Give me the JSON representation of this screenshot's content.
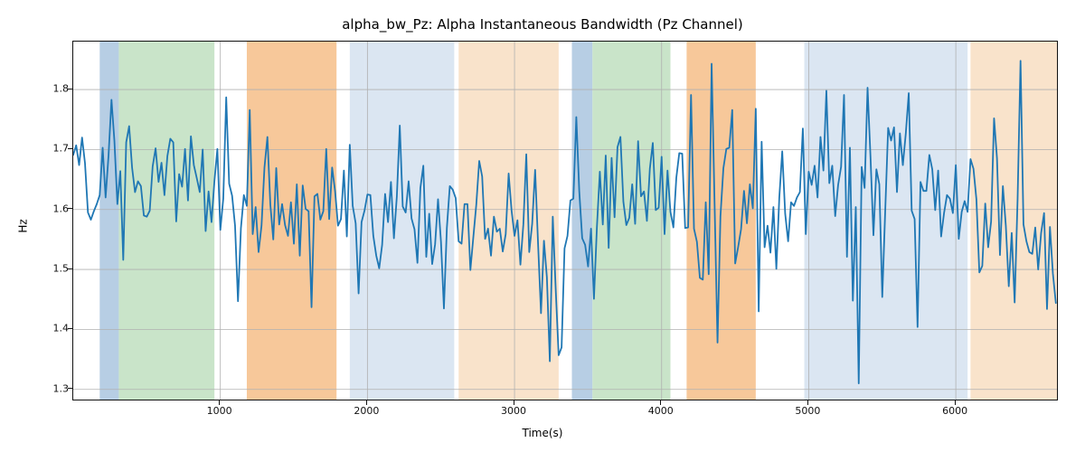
{
  "chart_data": {
    "type": "line",
    "title": "alpha_bw_Pz: Alpha Instantaneous Bandwidth (Pz Channel)",
    "xlabel": "Time(s)",
    "ylabel": "Hz",
    "xlim": [
      0,
      6700
    ],
    "ylim": [
      1.28,
      1.88
    ],
    "xticks": [
      1000,
      2000,
      3000,
      4000,
      5000,
      6000
    ],
    "yticks": [
      1.3,
      1.4,
      1.5,
      1.6,
      1.7,
      1.8
    ],
    "line_color": "#1f77b4",
    "grid": true,
    "bands": [
      {
        "x0": 180,
        "x1": 310,
        "color": "#b7cee4"
      },
      {
        "x0": 310,
        "x1": 960,
        "color": "#c9e4c9"
      },
      {
        "x0": 1180,
        "x1": 1790,
        "color": "#f7c89a"
      },
      {
        "x0": 1880,
        "x1": 1980,
        "color": "#dbe6f2"
      },
      {
        "x0": 1980,
        "x1": 2590,
        "color": "#dbe6f2"
      },
      {
        "x0": 2620,
        "x1": 3300,
        "color": "#f9e3cb"
      },
      {
        "x0": 3390,
        "x1": 3530,
        "color": "#b7cee4"
      },
      {
        "x0": 3530,
        "x1": 4060,
        "color": "#c9e4c9"
      },
      {
        "x0": 4170,
        "x1": 4640,
        "color": "#f7c89a"
      },
      {
        "x0": 4970,
        "x1": 6080,
        "color": "#dbe6f2"
      },
      {
        "x0": 6100,
        "x1": 6700,
        "color": "#f9e3cb"
      }
    ],
    "series": [
      {
        "name": "alpha_bw_Pz",
        "x_step": 20,
        "x_start": 0,
        "values": [
          1.691,
          1.707,
          1.674,
          1.72,
          1.677,
          1.595,
          1.583,
          1.597,
          1.609,
          1.624,
          1.703,
          1.62,
          1.69,
          1.783,
          1.714,
          1.609,
          1.664,
          1.516,
          1.712,
          1.739,
          1.67,
          1.629,
          1.647,
          1.639,
          1.59,
          1.588,
          1.598,
          1.672,
          1.702,
          1.646,
          1.678,
          1.624,
          1.689,
          1.718,
          1.712,
          1.58,
          1.659,
          1.638,
          1.701,
          1.615,
          1.722,
          1.674,
          1.652,
          1.629,
          1.7,
          1.564,
          1.63,
          1.579,
          1.648,
          1.701,
          1.566,
          1.618,
          1.787,
          1.643,
          1.623,
          1.573,
          1.447,
          1.569,
          1.624,
          1.606,
          1.766,
          1.559,
          1.604,
          1.529,
          1.573,
          1.67,
          1.721,
          1.608,
          1.55,
          1.669,
          1.575,
          1.609,
          1.574,
          1.556,
          1.612,
          1.543,
          1.642,
          1.523,
          1.64,
          1.601,
          1.597,
          1.437,
          1.622,
          1.626,
          1.583,
          1.597,
          1.701,
          1.584,
          1.67,
          1.631,
          1.573,
          1.584,
          1.665,
          1.555,
          1.708,
          1.606,
          1.577,
          1.46,
          1.579,
          1.598,
          1.625,
          1.624,
          1.556,
          1.523,
          1.502,
          1.541,
          1.626,
          1.579,
          1.646,
          1.552,
          1.622,
          1.74,
          1.605,
          1.595,
          1.647,
          1.585,
          1.567,
          1.511,
          1.636,
          1.673,
          1.521,
          1.593,
          1.509,
          1.542,
          1.617,
          1.546,
          1.435,
          1.569,
          1.639,
          1.633,
          1.619,
          1.547,
          1.543,
          1.609,
          1.609,
          1.499,
          1.554,
          1.608,
          1.681,
          1.655,
          1.551,
          1.568,
          1.523,
          1.588,
          1.563,
          1.568,
          1.53,
          1.559,
          1.66,
          1.598,
          1.556,
          1.582,
          1.508,
          1.575,
          1.692,
          1.529,
          1.576,
          1.666,
          1.543,
          1.427,
          1.548,
          1.487,
          1.347,
          1.588,
          1.467,
          1.357,
          1.37,
          1.535,
          1.556,
          1.615,
          1.618,
          1.754,
          1.631,
          1.552,
          1.541,
          1.505,
          1.568,
          1.451,
          1.57,
          1.663,
          1.575,
          1.69,
          1.536,
          1.686,
          1.587,
          1.704,
          1.721,
          1.613,
          1.574,
          1.586,
          1.642,
          1.576,
          1.714,
          1.622,
          1.63,
          1.581,
          1.668,
          1.711,
          1.599,
          1.603,
          1.688,
          1.559,
          1.665,
          1.596,
          1.57,
          1.653,
          1.694,
          1.693,
          1.569,
          1.57,
          1.791,
          1.568,
          1.546,
          1.486,
          1.483,
          1.612,
          1.492,
          1.843,
          1.61,
          1.378,
          1.589,
          1.669,
          1.701,
          1.703,
          1.766,
          1.51,
          1.537,
          1.567,
          1.631,
          1.577,
          1.642,
          1.602,
          1.768,
          1.43,
          1.713,
          1.537,
          1.573,
          1.528,
          1.604,
          1.501,
          1.62,
          1.697,
          1.593,
          1.547,
          1.612,
          1.606,
          1.62,
          1.629,
          1.735,
          1.559,
          1.663,
          1.641,
          1.673,
          1.62,
          1.721,
          1.665,
          1.798,
          1.644,
          1.673,
          1.589,
          1.641,
          1.671,
          1.791,
          1.521,
          1.703,
          1.448,
          1.604,
          1.31,
          1.671,
          1.636,
          1.803,
          1.688,
          1.557,
          1.667,
          1.642,
          1.454,
          1.597,
          1.736,
          1.715,
          1.737,
          1.629,
          1.727,
          1.674,
          1.727,
          1.794,
          1.598,
          1.584,
          1.404,
          1.646,
          1.631,
          1.631,
          1.691,
          1.667,
          1.599,
          1.665,
          1.555,
          1.594,
          1.624,
          1.618,
          1.594,
          1.674,
          1.551,
          1.596,
          1.614,
          1.596,
          1.684,
          1.668,
          1.617,
          1.495,
          1.506,
          1.61,
          1.537,
          1.58,
          1.752,
          1.685,
          1.524,
          1.639,
          1.573,
          1.472,
          1.561,
          1.445,
          1.617,
          1.848,
          1.575,
          1.547,
          1.529,
          1.526,
          1.57,
          1.5,
          1.561,
          1.594,
          1.434,
          1.571,
          1.493,
          1.444
        ]
      }
    ]
  }
}
